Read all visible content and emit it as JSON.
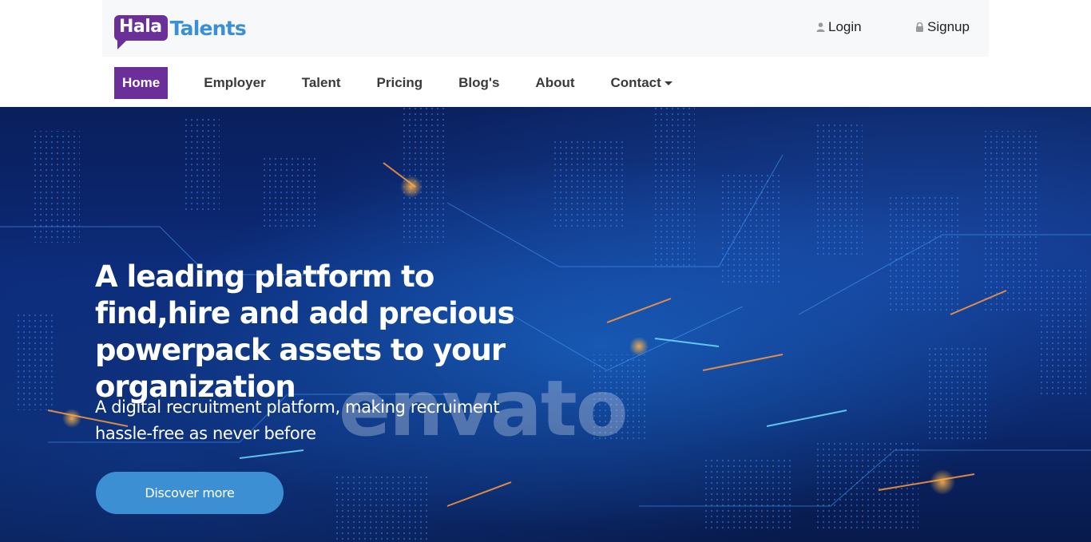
{
  "logo": {
    "part1": "Hala",
    "part2": "Talents"
  },
  "header": {
    "login_label": "Login",
    "signup_label": "Signup",
    "login_icon": "user-icon",
    "signup_icon": "lock-icon"
  },
  "nav": {
    "items": [
      {
        "label": "Home",
        "active": true
      },
      {
        "label": "Employer"
      },
      {
        "label": "Talent"
      },
      {
        "label": "Pricing"
      },
      {
        "label": "Blog's"
      },
      {
        "label": "About"
      },
      {
        "label": "Contact",
        "dropdown": true
      }
    ]
  },
  "hero": {
    "title": "A leading platform to find,hire and add precious powerpack assets to your organization",
    "subtitle": "A digital recruitment platform, making recruiment hassle-free as never before",
    "cta_label": "Discover more",
    "watermark": "envato"
  },
  "colors": {
    "brand_purple": "#6a2f98",
    "brand_blue": "#3a8fd8",
    "cta_blue": "#3d8fd4",
    "hero_dark": "#0a1f5c"
  }
}
